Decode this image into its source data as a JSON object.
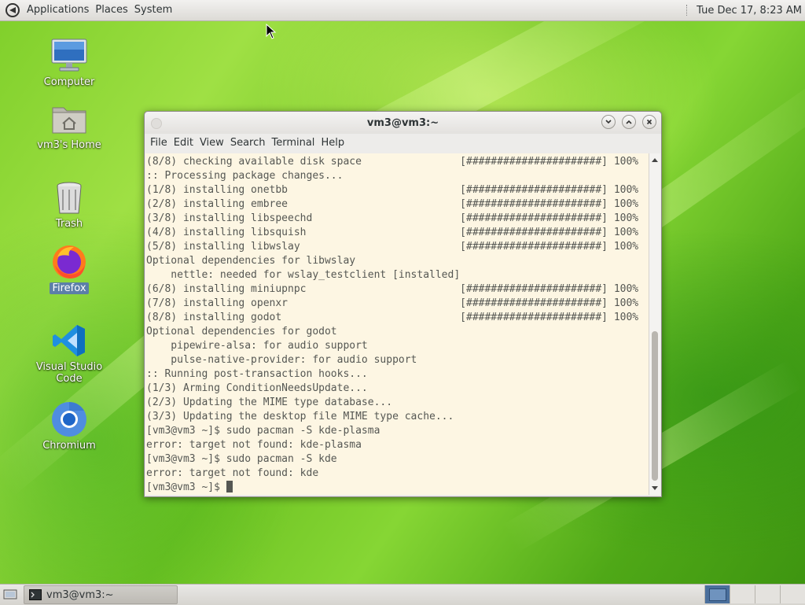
{
  "top_panel": {
    "menus": [
      "Applications",
      "Places",
      "System"
    ],
    "clock": "Tue Dec 17,  8:23 AM"
  },
  "desktop_icons": [
    {
      "label": "Computer",
      "icon": "computer-icon"
    },
    {
      "label": "vm3's Home",
      "icon": "home-folder-icon"
    },
    {
      "label": "Trash",
      "icon": "trash-icon"
    },
    {
      "label": "Firefox",
      "icon": "firefox-icon",
      "selected": true
    },
    {
      "label": "Visual Studio Code",
      "icon": "vscode-icon"
    },
    {
      "label": "Chromium",
      "icon": "chromium-icon"
    }
  ],
  "terminal": {
    "title": "vm3@vm3:~",
    "menu": [
      "File",
      "Edit",
      "View",
      "Search",
      "Terminal",
      "Help"
    ],
    "lines": [
      "(8/8) checking available disk space                [######################] 100%",
      ":: Processing package changes...",
      "(1/8) installing onetbb                            [######################] 100%",
      "(2/8) installing embree                            [######################] 100%",
      "(3/8) installing libspeechd                        [######################] 100%",
      "(4/8) installing libsquish                         [######################] 100%",
      "(5/8) installing libwslay                          [######################] 100%",
      "Optional dependencies for libwslay",
      "    nettle: needed for wslay_testclient [installed]",
      "(6/8) installing miniupnpc                         [######################] 100%",
      "(7/8) installing openxr                            [######################] 100%",
      "(8/8) installing godot                             [######################] 100%",
      "Optional dependencies for godot",
      "    pipewire-alsa: for audio support",
      "    pulse-native-provider: for audio support",
      ":: Running post-transaction hooks...",
      "(1/3) Arming ConditionNeedsUpdate...",
      "(2/3) Updating the MIME type database...",
      "(3/3) Updating the desktop file MIME type cache...",
      "[vm3@vm3 ~]$ sudo pacman -S kde-plasma",
      "error: target not found: kde-plasma",
      "[vm3@vm3 ~]$ sudo pacman -S kde",
      "error: target not found: kde"
    ],
    "prompt": "[vm3@vm3 ~]$ "
  },
  "taskbar": {
    "task_label": "vm3@vm3:~",
    "workspaces": 4,
    "active_workspace": 1
  },
  "colors": {
    "terminal_bg": "#fdf6e3",
    "terminal_fg": "#555753",
    "selection": "#5c7fa8"
  }
}
